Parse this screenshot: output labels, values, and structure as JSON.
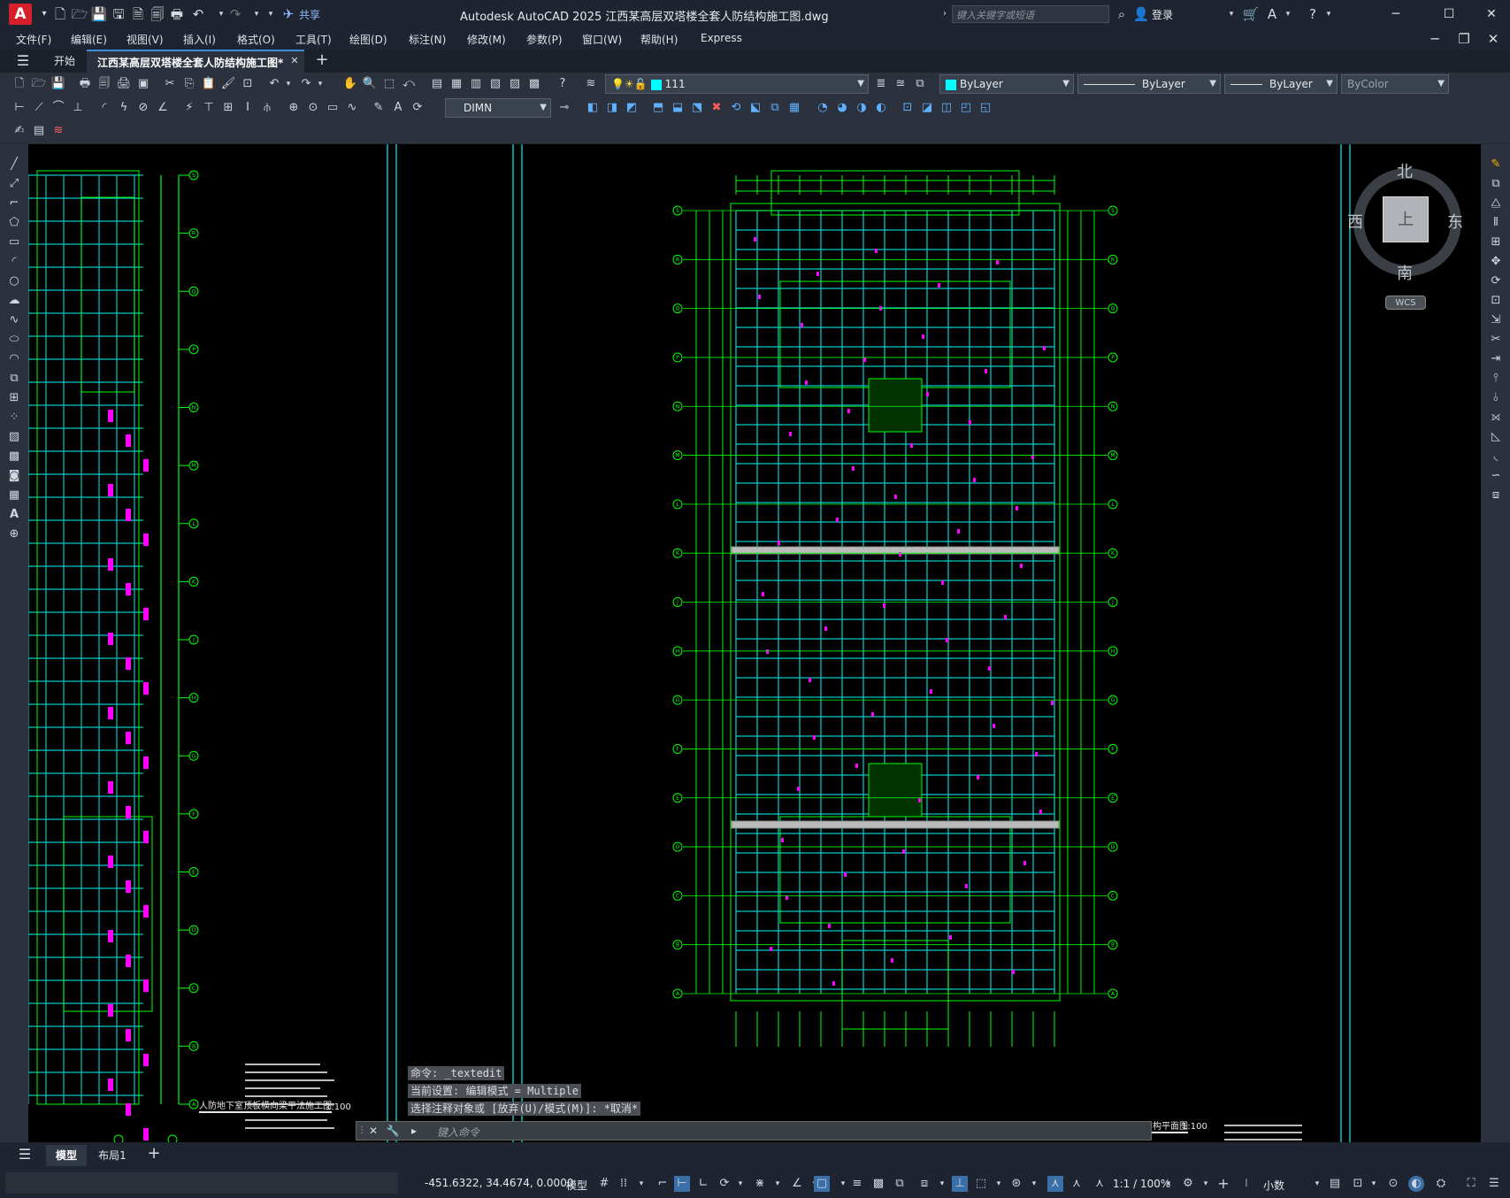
{
  "title_bar": {
    "logo": "A",
    "share": "共享",
    "title": "Autodesk AutoCAD 2025    江西某高层双塔楼全套人防结构施工图.dwg",
    "search_placeholder": "键入关键字或短语",
    "login": "登录"
  },
  "menu": [
    "文件(F)",
    "编辑(E)",
    "视图(V)",
    "插入(I)",
    "格式(O)",
    "工具(T)",
    "绘图(D)",
    "标注(N)",
    "修改(M)",
    "参数(P)",
    "窗口(W)",
    "帮助(H)",
    "Express"
  ],
  "tabs": {
    "start": "开始",
    "file": "江西某高层双塔楼全套人防结构施工图*"
  },
  "toolbar": {
    "layer_name": "111",
    "color": "ByLayer",
    "linetype": "ByLayer",
    "lineweight": "ByLayer",
    "plotstyle": "ByColor",
    "dimstyle": "DIMN"
  },
  "viewcube": {
    "north": "北",
    "south": "南",
    "west": "西",
    "east": "东",
    "face": "上",
    "wcs": "WCS"
  },
  "drawing": {
    "left_title": "人防地下室顶板横向梁平法施工图",
    "left_scale": "1:100",
    "right_title": "人防地下室顶板结构平面图",
    "right_scale": "1:100",
    "left_axis_labels": [
      "S",
      "R",
      "Q",
      "P",
      "N",
      "M",
      "L",
      "K",
      "J",
      "H",
      "G",
      "F",
      "E",
      "D",
      "C",
      "B",
      "A"
    ],
    "right_axis_labels": [
      "S",
      "R",
      "Q",
      "P",
      "N",
      "M",
      "L",
      "K",
      "J",
      "H",
      "G",
      "F",
      "E",
      "D",
      "C",
      "B",
      "A"
    ]
  },
  "command": {
    "history": [
      "命令: _textedit",
      "当前设置: 编辑模式 = Multiple",
      "选择注释对象或 [放弃(U)/模式(M)]: *取消*"
    ],
    "input_placeholder": "键入命令"
  },
  "layout_tabs": {
    "model": "模型",
    "layout1": "布局1"
  },
  "status": {
    "coords": "-451.6322, 34.4674, 0.0000",
    "model": "模型",
    "scale": "1:1 / 100%",
    "units": "小数"
  },
  "colors": {
    "accent": "#3b8de0",
    "grid": "#00ff00",
    "beam": "#00c8c8",
    "annot": "#ff00ff"
  }
}
